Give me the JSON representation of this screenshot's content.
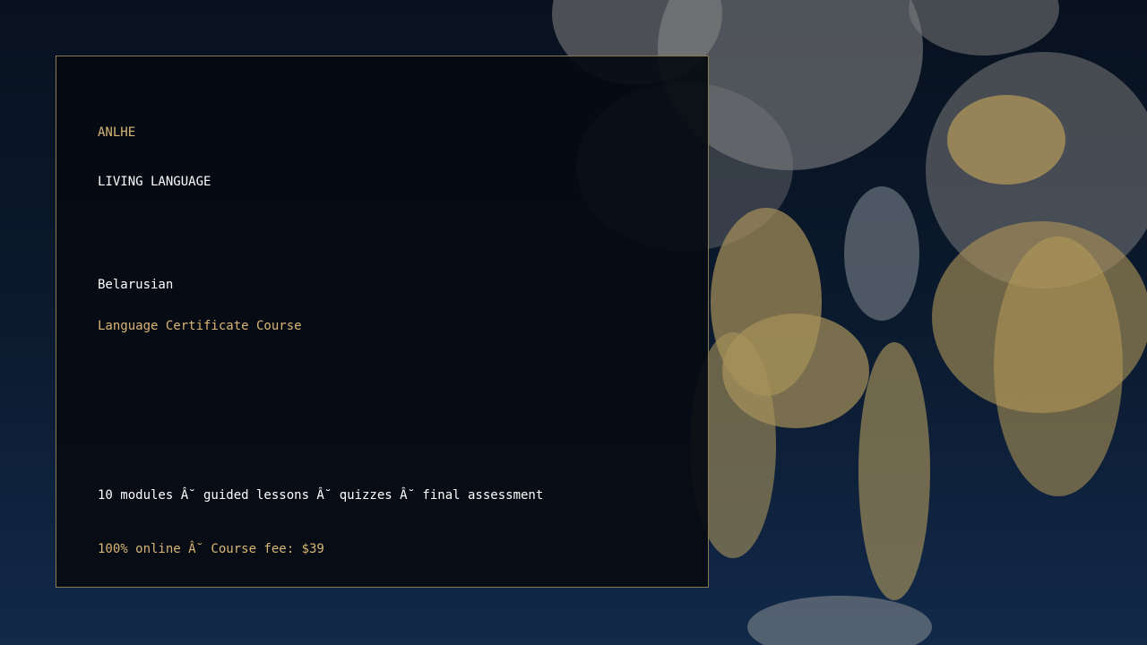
{
  "brand": "ANLHE",
  "tagline": "LIVING LANGUAGE",
  "language": "Belarusian",
  "course_type": "Language Certificate Course",
  "features": "10 modules Â˘ guided lessons Â˘ quizzes Â˘ final assessment",
  "pricing": "100% online Â˘ Course fee: $39",
  "colors": {
    "accent_gold": "#d9b676",
    "text_white": "#ffffff",
    "border": "#8a7a52",
    "background_top": "#08111f",
    "background_bottom": "#12294a"
  }
}
